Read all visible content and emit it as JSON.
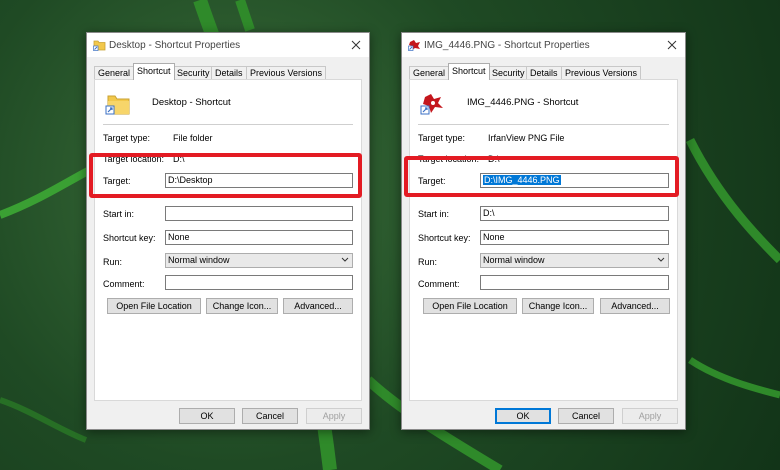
{
  "dialogs": [
    {
      "title": "Desktop - Shortcut Properties",
      "tabs": [
        "General",
        "Shortcut",
        "Security",
        "Details",
        "Previous Versions"
      ],
      "active_tab": "Shortcut",
      "header_name": "Desktop - Shortcut",
      "target_type_label": "Target type:",
      "target_type_value": "File folder",
      "target_location_label": "Target location:",
      "target_location_value": "D:\\",
      "target_label": "Target:",
      "target_value": "D:\\Desktop",
      "start_in_label": "Start in:",
      "start_in_value": "",
      "shortcut_key_label": "Shortcut key:",
      "shortcut_key_value": "None",
      "run_label": "Run:",
      "run_value": "Normal window",
      "comment_label": "Comment:",
      "comment_value": "",
      "buttons": {
        "open_file_location": "Open File Location",
        "change_icon": "Change Icon...",
        "advanced": "Advanced..."
      },
      "footer": {
        "ok": "OK",
        "cancel": "Cancel",
        "apply": "Apply"
      }
    },
    {
      "title": "IMG_4446.PNG - Shortcut Properties",
      "tabs": [
        "General",
        "Shortcut",
        "Security",
        "Details",
        "Previous Versions"
      ],
      "active_tab": "Shortcut",
      "header_name": "IMG_4446.PNG - Shortcut",
      "target_type_label": "Target type:",
      "target_type_value": "IrfanView PNG File",
      "target_location_label": "Target location:",
      "target_location_value": "D:\\",
      "target_label": "Target:",
      "target_value": "D:\\IMG_4446.PNG",
      "start_in_label": "Start in:",
      "start_in_value": "D:\\",
      "shortcut_key_label": "Shortcut key:",
      "shortcut_key_value": "None",
      "run_label": "Run:",
      "run_value": "Normal window",
      "comment_label": "Comment:",
      "comment_value": "",
      "buttons": {
        "open_file_location": "Open File Location",
        "change_icon": "Change Icon...",
        "advanced": "Advanced..."
      },
      "footer": {
        "ok": "OK",
        "cancel": "Cancel",
        "apply": "Apply"
      }
    }
  ],
  "icons": {
    "dialog1": "folder-shortcut-icon",
    "dialog2": "irfanview-icon",
    "close": "close-icon",
    "dropdown": "chevron-down-icon"
  },
  "colors": {
    "highlight": "#e31b23",
    "selection": "#0078d7",
    "background_leaf": "#1f4a24"
  }
}
